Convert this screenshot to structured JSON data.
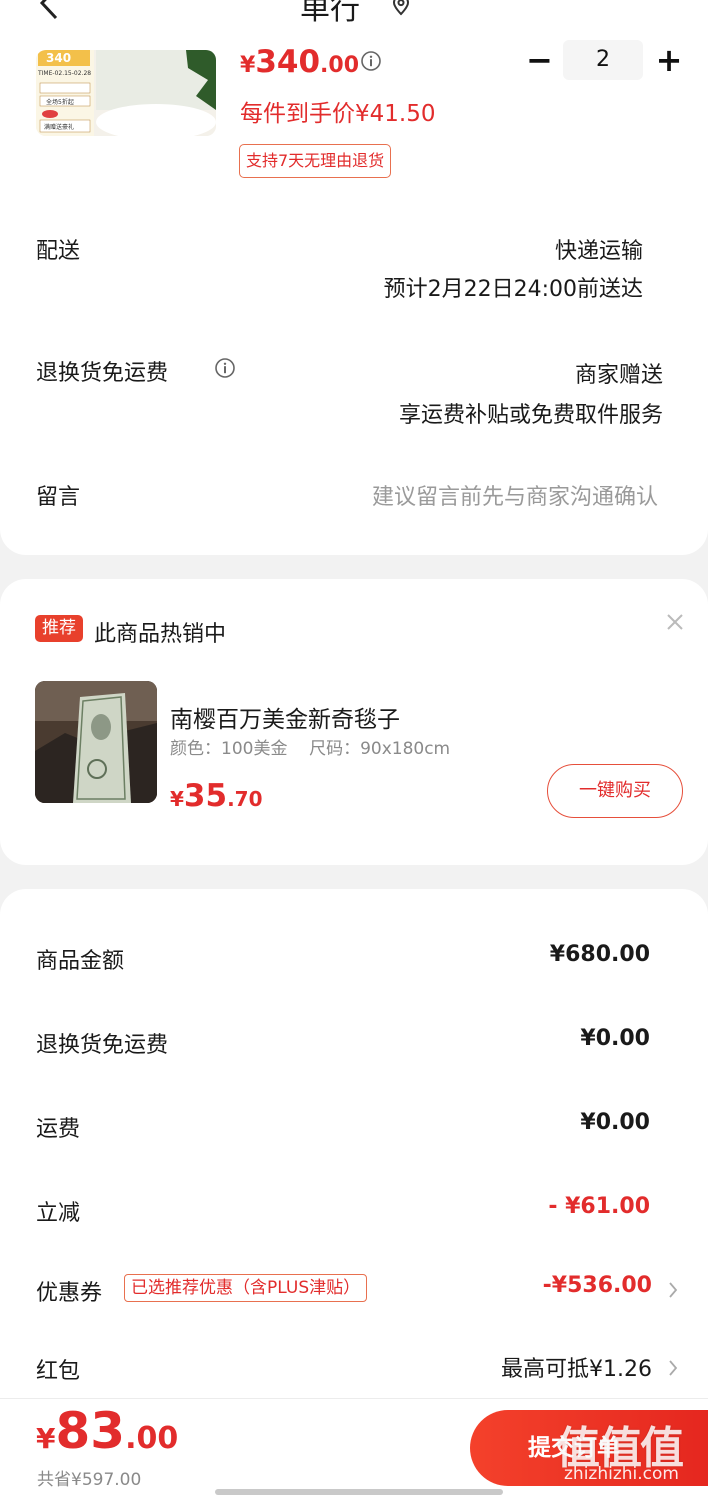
{
  "header": {
    "title": "单行"
  },
  "product": {
    "price_yen": "¥",
    "price_int": "340",
    "price_dec": ".00",
    "quantity": "2",
    "minus_label": "−",
    "plus_label": "+",
    "unit_price": "每件到手价¥41.50",
    "return_policy": "支持7天无理由退货",
    "image_lines": [
      "340",
      "TIME-02.15-02.28",
      "全场5折起",
      "满赠送豪礼"
    ]
  },
  "delivery": {
    "label": "配送",
    "method": "快递运输",
    "eta": "预计2月22日24:00前送达"
  },
  "return_shipping": {
    "label": "退换货免运费",
    "value": "商家赠送",
    "detail": "享运费补贴或免费取件服务"
  },
  "message": {
    "label": "留言",
    "placeholder": "建议留言前先与商家沟通确认"
  },
  "recommend": {
    "tag": "推荐",
    "title": "此商品热销中",
    "product_name": "南樱百万美金新奇毯子",
    "spec": "颜色：100美金    尺码：90x180cm",
    "price_yen": "¥",
    "price_int": "35",
    "price_dec": ".70",
    "buy_label": "一键购买"
  },
  "summary": {
    "rows": [
      {
        "label": "商品金额",
        "value": "¥680.00"
      },
      {
        "label": "退换货免运费",
        "value": "¥0.00"
      },
      {
        "label": "运费",
        "value": "¥0.00"
      },
      {
        "label": "立减",
        "value": "- ¥61.00"
      },
      {
        "label": "优惠券",
        "tag": "已选推荐优惠（含PLUS津贴）",
        "value": "-¥536.00"
      },
      {
        "label": "红包",
        "value": "最高可抵¥1.26"
      }
    ]
  },
  "footer": {
    "total_yen": "¥",
    "total_int": "83",
    "total_dec": ".00",
    "saved": "共省¥597.00",
    "submit_label": "提交订单",
    "watermark": "值值值",
    "watermark_url": "zhizhizhi.com"
  },
  "colors": {
    "accent": "#e22c2c",
    "background": "#f2f2f2",
    "card": "#ffffff"
  },
  "icons": [
    "back-icon",
    "location-pin-icon",
    "info-icon",
    "close-icon",
    "chevron-right-icon"
  ]
}
